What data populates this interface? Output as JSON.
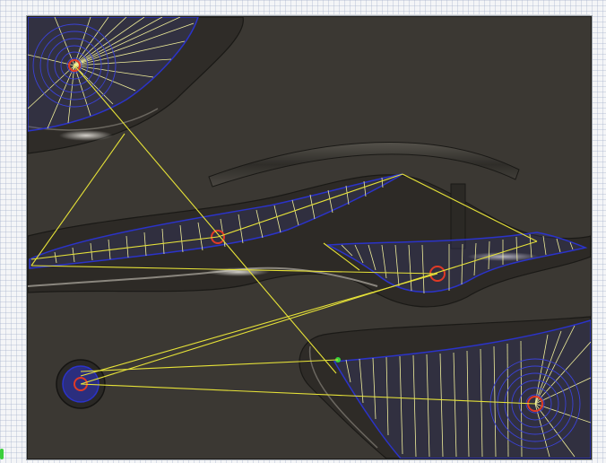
{
  "viewport": {
    "background": "#3b3833",
    "grid_paper": "#f4f5f7",
    "part_surface": "#2c2a26",
    "raised_surface": "#45423c"
  },
  "toolpaths": {
    "boundary_color": "#2b33c9",
    "hatch_color": "#f0ee9a",
    "link_color": "#e6e238",
    "center_color": "#e03a26",
    "marker_color": "#36d63a"
  },
  "regions": [
    {
      "name": "top-left-pocket"
    },
    {
      "name": "middle-left-pocket"
    },
    {
      "name": "middle-right-pocket"
    },
    {
      "name": "bottom-left-circle-pocket"
    },
    {
      "name": "bottom-right-pocket"
    }
  ]
}
